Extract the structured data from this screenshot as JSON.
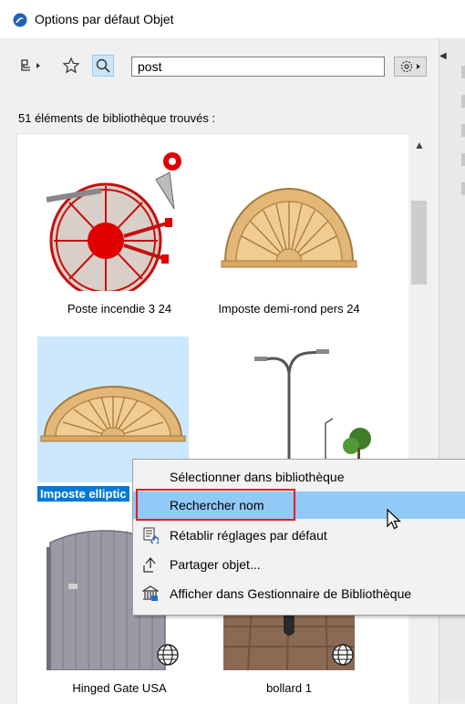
{
  "window": {
    "title": "Options par défaut Objet"
  },
  "toolbar": {
    "tree_icon": "tree-view-icon",
    "favorites_icon": "star-icon",
    "search_icon": "search-icon",
    "settings_icon": "gear-icon"
  },
  "search": {
    "value": "post"
  },
  "results": {
    "count_text": "51 éléments de bibliothèque trouvés :"
  },
  "items": [
    {
      "label": "Poste incendie 3 24"
    },
    {
      "label": "Imposte demi-rond pers 24"
    },
    {
      "label": "Imposte elliptic"
    },
    {
      "label": ""
    },
    {
      "label": "Hinged Gate USA"
    },
    {
      "label": "bollard 1"
    }
  ],
  "context_menu": {
    "items": [
      {
        "label": "Sélectionner dans bibliothèque"
      },
      {
        "label": "Rechercher nom"
      },
      {
        "label": "Rétablir réglages par défaut"
      },
      {
        "label": "Partager objet..."
      },
      {
        "label": "Afficher dans Gestionnaire de Bibliothèque"
      }
    ]
  },
  "colors": {
    "selection": "#cce8ff",
    "menu_hover": "#91c9f7",
    "highlight": "#e02020"
  }
}
